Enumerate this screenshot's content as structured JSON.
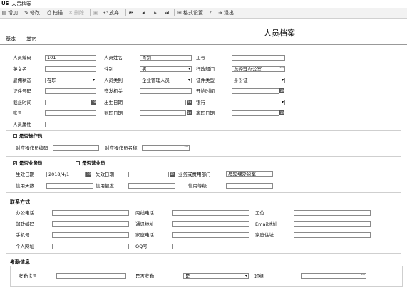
{
  "window": {
    "logo": "US",
    "title": "人员档案"
  },
  "toolbar": {
    "add": "增加",
    "edit": "修改",
    "scan": "扫描",
    "delete": "删除",
    "save": "",
    "undo": "放弃",
    "format": "格式设置",
    "exit": "退出"
  },
  "heading": "人员档案",
  "tabs": [
    "基本",
    "其它"
  ],
  "fields": {
    "emp_code_label": "人员编码",
    "emp_code_value": "101",
    "emp_name_label": "人员姓名",
    "emp_name_value": "肖剑",
    "job_no_label": "工号",
    "eng_name_label": "英文名",
    "gender_label": "性别",
    "gender_value": "男",
    "dept_label": "行政部门",
    "dept_value": "总经理办公室",
    "status_label": "雇佣状态",
    "status_value": "在职",
    "category_label": "人员类别",
    "category_value": "企业管理人员",
    "id_type_label": "证件类型",
    "id_type_value": "身份证",
    "id_no_label": "证件号码",
    "issuer_label": "签发机关",
    "start_label": "开始时间",
    "end_label": "截止时间",
    "birth_label": "出生日期",
    "bank_label": "银行",
    "account_label": "账号",
    "arrive_label": "到职日期",
    "leave_label": "离职日期",
    "attr_label": "人员属性"
  },
  "operator": {
    "checkbox_label": "是否操作员",
    "code_label": "对应操作员编码",
    "name_label": "对应操作员名称"
  },
  "business": {
    "biz_label": "是否业务员",
    "biz_checked": "✓",
    "sales_label": "是否营业员",
    "eff_label": "生效日期",
    "eff_value": "2018/4/1",
    "exp_label": "失效日期",
    "dept_label": "业务或费用部门",
    "dept_value": "总经理办公室",
    "credit_days_label": "信用天数",
    "credit_limit_label": "信用额度",
    "credit_grade_label": "信用等级"
  },
  "contact": {
    "section": "联系方式",
    "office_phone": "办公电话",
    "ext_phone": "内线电话",
    "station": "工位",
    "postcode": "邮政编码",
    "address": "通讯地址",
    "email": "Email地址",
    "mobile": "手机号",
    "home_phone": "家庭电话",
    "home_address": "家庭住址",
    "homepage": "个人网址",
    "qq": "QQ号"
  },
  "attendance": {
    "section": "考勤信息",
    "card_label": "考勤卡号",
    "flag_label": "是否考勤",
    "flag_value": "是",
    "shift_label": "班组"
  }
}
